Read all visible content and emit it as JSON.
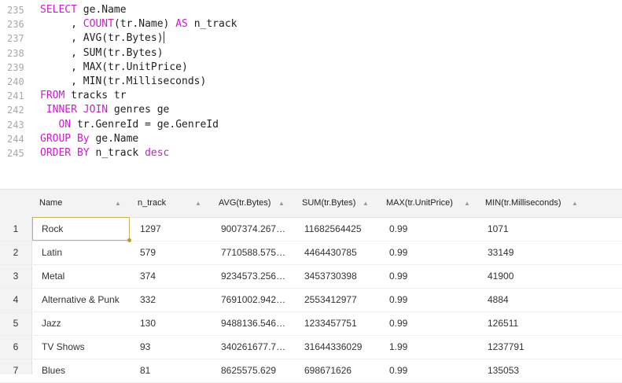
{
  "editor": {
    "lines": [
      {
        "num": "235",
        "parts": [
          {
            "t": "SELECT",
            "k": true
          },
          {
            "t": " ge.Name",
            "k": false
          }
        ]
      },
      {
        "num": "236",
        "parts": [
          {
            "t": "     , ",
            "k": false
          },
          {
            "t": "COUNT",
            "k": true
          },
          {
            "t": "(tr.Name) ",
            "k": false
          },
          {
            "t": "AS",
            "k": true
          },
          {
            "t": " n_track",
            "k": false
          }
        ]
      },
      {
        "num": "237",
        "parts": [
          {
            "t": "     , AVG(tr.Bytes)",
            "k": false
          }
        ],
        "cursor": true
      },
      {
        "num": "238",
        "parts": [
          {
            "t": "     , SUM(tr.Bytes)",
            "k": false
          }
        ]
      },
      {
        "num": "239",
        "parts": [
          {
            "t": "     , MAX(tr.UnitPrice)",
            "k": false
          }
        ]
      },
      {
        "num": "240",
        "parts": [
          {
            "t": "     , MIN(tr.Milliseconds)",
            "k": false
          }
        ]
      },
      {
        "num": "241",
        "parts": [
          {
            "t": "FROM",
            "k": true
          },
          {
            "t": " tracks tr",
            "k": false
          }
        ]
      },
      {
        "num": "242",
        "parts": [
          {
            "t": " ",
            "k": false
          },
          {
            "t": "INNER JOIN",
            "k": true
          },
          {
            "t": " genres ge",
            "k": false
          }
        ]
      },
      {
        "num": "243",
        "parts": [
          {
            "t": "   ",
            "k": false
          },
          {
            "t": "ON",
            "k": true
          },
          {
            "t": " tr.GenreId = ge.GenreId",
            "k": false
          }
        ]
      },
      {
        "num": "244",
        "parts": [
          {
            "t": "GROUP By",
            "k": true
          },
          {
            "t": " ge.Name",
            "k": false
          }
        ]
      },
      {
        "num": "245",
        "parts": [
          {
            "t": "ORDER BY",
            "k": true
          },
          {
            "t": " n_track ",
            "k": false
          },
          {
            "t": "desc",
            "k": true
          }
        ]
      }
    ]
  },
  "results": {
    "columns": [
      "Name",
      "n_track",
      "AVG(tr.Bytes)",
      "SUM(tr.Bytes)",
      "MAX(tr.UnitPrice)",
      "MIN(tr.Milliseconds)"
    ],
    "rows": [
      [
        "1",
        "Rock",
        "1297",
        "9007374.267…",
        "11682564425",
        "0.99",
        "1071"
      ],
      [
        "2",
        "Latin",
        "579",
        "7710588.575…",
        "4464430785",
        "0.99",
        "33149"
      ],
      [
        "3",
        "Metal",
        "374",
        "9234573.256…",
        "3453730398",
        "0.99",
        "41900"
      ],
      [
        "4",
        "Alternative & Punk",
        "332",
        "7691002.942…",
        "2553412977",
        "0.99",
        "4884"
      ],
      [
        "5",
        "Jazz",
        "130",
        "9488136.546…",
        "1233457751",
        "0.99",
        "126511"
      ],
      [
        "6",
        "TV Shows",
        "93",
        "340261677.7…",
        "31644336029",
        "1.99",
        "1237791"
      ],
      [
        "7",
        "Blues",
        "81",
        "8625575.629",
        "698671626",
        "0.99",
        "135053"
      ]
    ],
    "selected_cell": "Rock",
    "sort_icon": "sort-triangle-icon"
  },
  "colors": {
    "keyword": "#c81ec8",
    "line_number": "#a8a8a8",
    "header_bg": "#f3f3f3",
    "selection_border": "#c8b060"
  }
}
